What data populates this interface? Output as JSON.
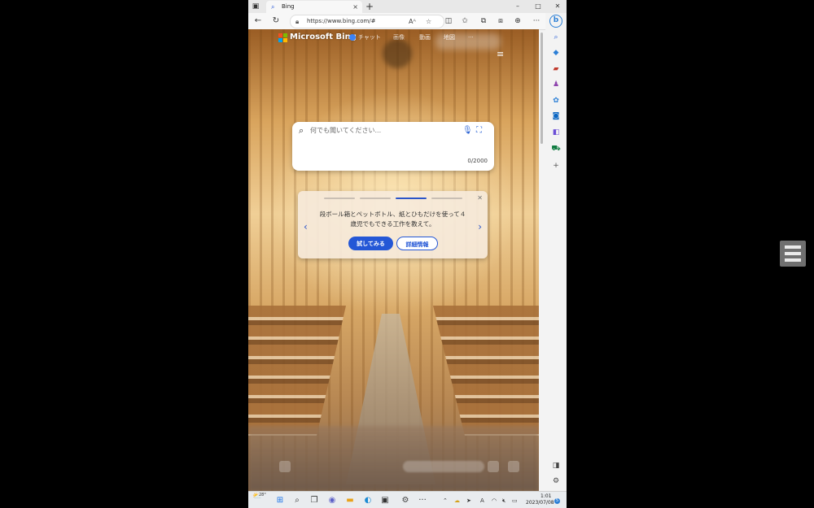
{
  "browser": {
    "tab": {
      "title": "Bing",
      "favicon": "search-icon",
      "close": "×"
    },
    "new_tab": "+",
    "window_controls": {
      "minimize": "–",
      "maximize": "□",
      "close": "✕"
    },
    "toolbar": {
      "back": "←",
      "refresh": "↻",
      "url": "https://www.bing.com/#",
      "read_aloud": "Aᴬ",
      "favorite": "☆",
      "more": "···"
    }
  },
  "bing": {
    "brand": "Microsoft Bing",
    "nav": [
      "チャット",
      "画像",
      "動画",
      "地図",
      "···"
    ],
    "hamburger": "≡",
    "search": {
      "placeholder": "何でも聞いてください...",
      "char_count": "0/2000"
    },
    "suggestion": {
      "text": "段ボール箱とペットボトル、紙とひもだけを使って４歳児でもできる工作を教えて。",
      "try_label": "試してみる",
      "details_label": "詳細情報",
      "active_step": 3,
      "total_steps": 4
    }
  },
  "taskbar": {
    "weather_temp": "28°",
    "time": "1:01",
    "date": "2023/07/08",
    "notifications": "5"
  },
  "colors": {
    "accent": "#2457d6",
    "copilot": "#2b7fd6"
  }
}
